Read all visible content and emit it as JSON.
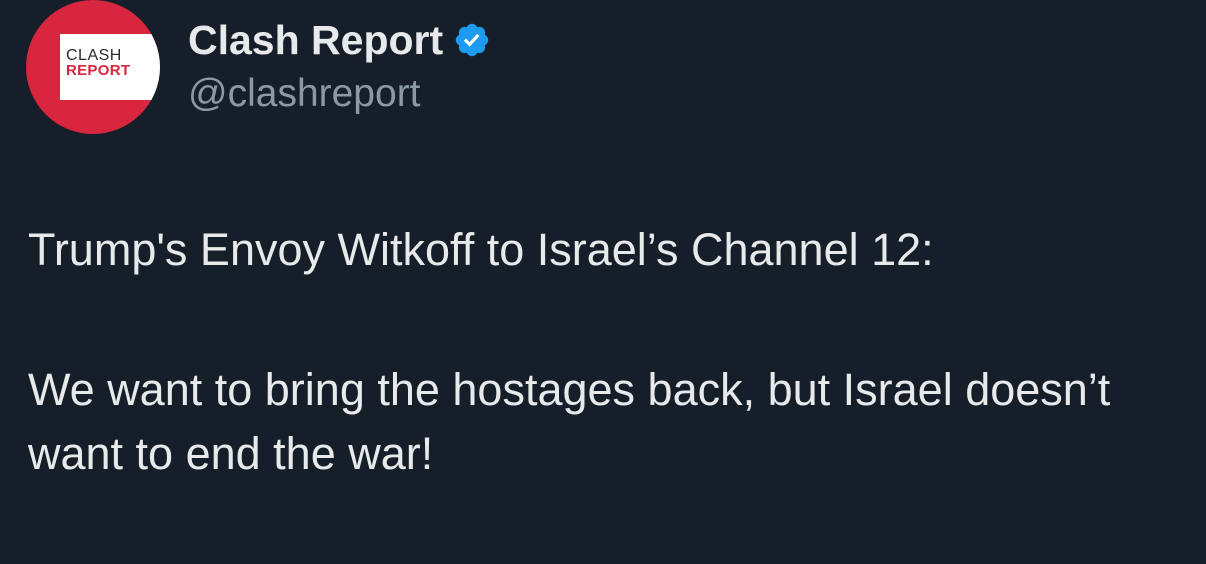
{
  "author": {
    "display_name": "Clash Report",
    "handle": "@clashreport",
    "verified": true,
    "verified_icon": "verified-badge-icon",
    "avatar": {
      "logo_line1": "CLASH",
      "logo_line2": "REPORT",
      "background_color": "#d7263d"
    }
  },
  "tweet": {
    "paragraphs": [
      "Trump's Envoy Witkoff to Israel’s Channel 12:",
      "We want to bring the hostages back, but Israel doesn’t want to end the war!"
    ]
  },
  "colors": {
    "background": "#161e29",
    "text": "#e7e9ea",
    "handle": "#8b98a5",
    "verified_blue": "#1d9bf0"
  }
}
